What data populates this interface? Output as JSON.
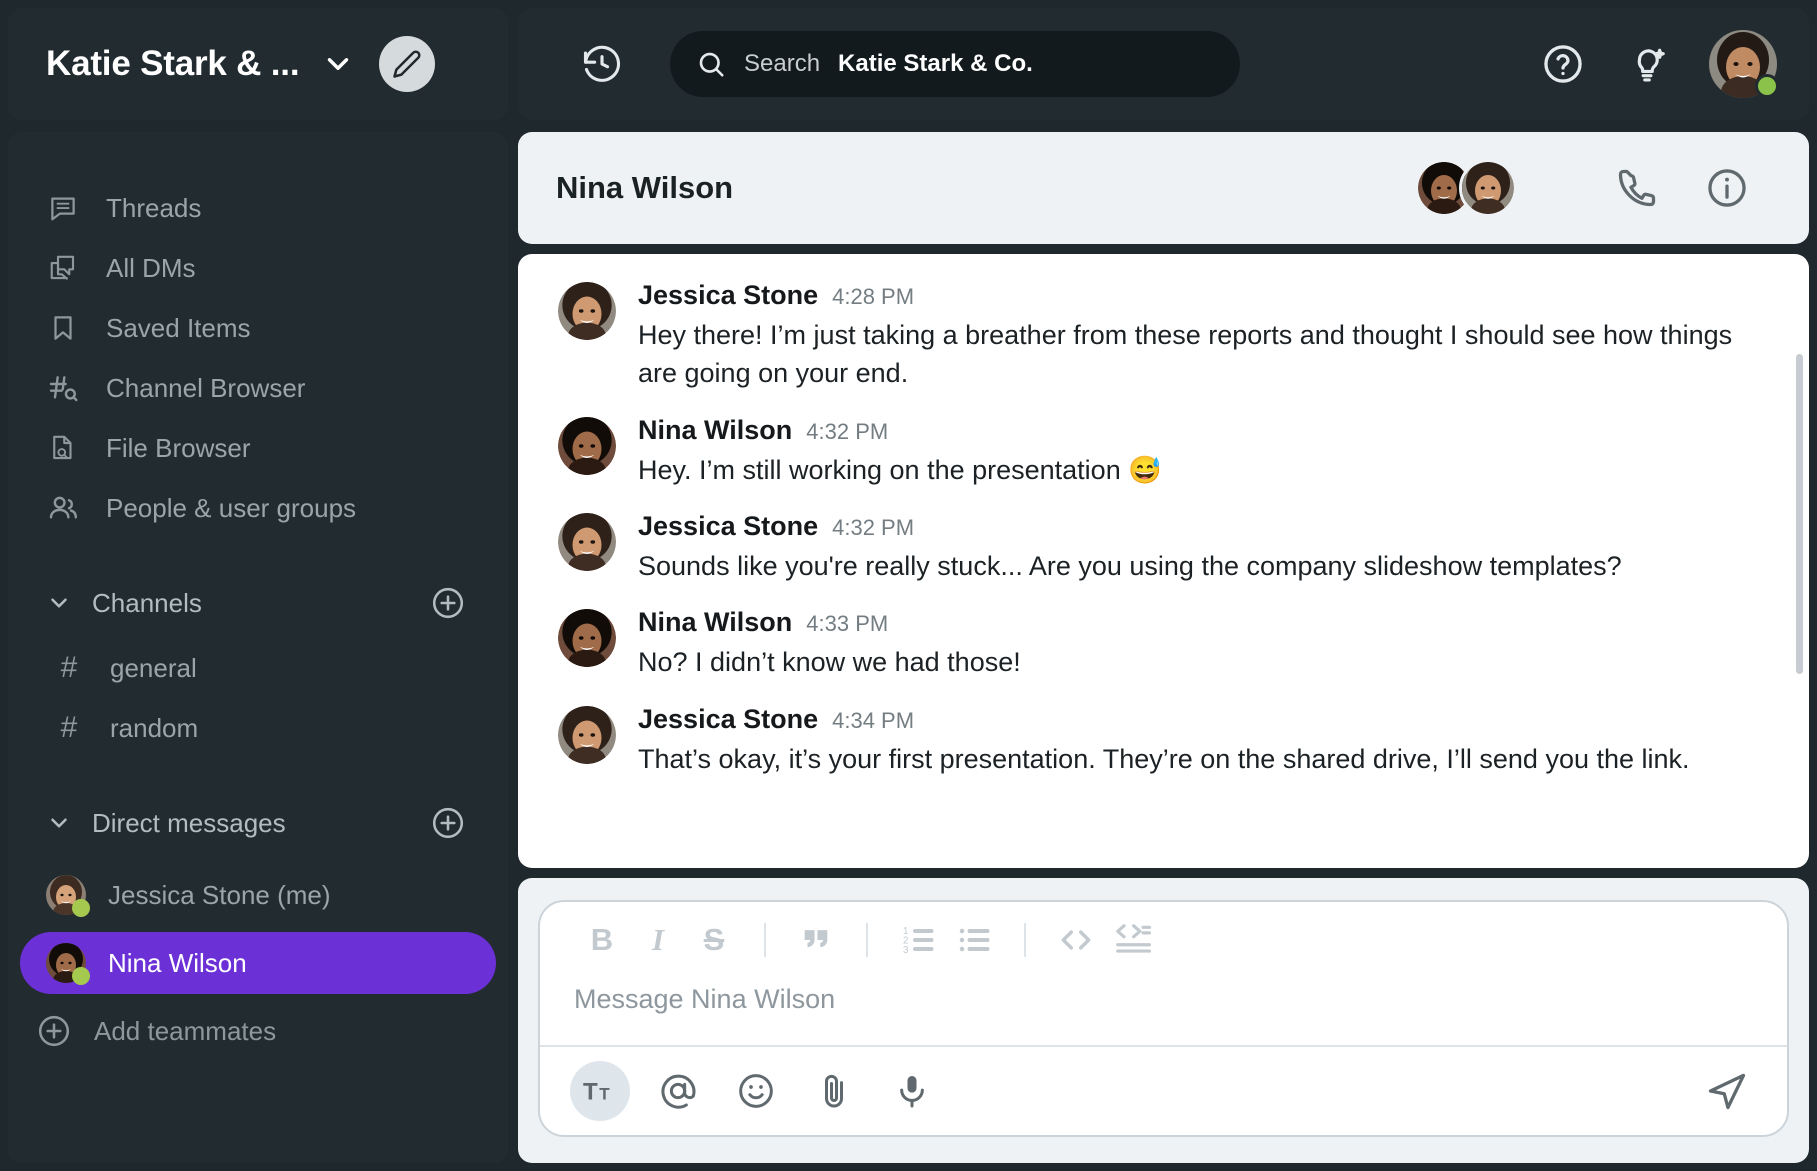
{
  "workspace": {
    "name": "Katie Stark & ...",
    "chevron_icon": "chevron-down-icon",
    "compose_icon": "pencil-edit-icon"
  },
  "header": {
    "history_icon": "history-clock-icon",
    "search": {
      "icon": "search-icon",
      "label": "Search",
      "scope": "Katie Stark & Co."
    },
    "help_icon": "help-circle-icon",
    "ideas_icon": "lightbulb-sparkle-icon",
    "avatar_icon": "user-avatar",
    "status_color": "#8bc34a"
  },
  "sidebar": {
    "nav_items": [
      {
        "label": "Threads",
        "icon": "threads-icon"
      },
      {
        "label": "All DMs",
        "icon": "all-dms-icon"
      },
      {
        "label": "Saved Items",
        "icon": "bookmark-icon"
      },
      {
        "label": "Channel Browser",
        "icon": "channel-search-icon"
      },
      {
        "label": "File Browser",
        "icon": "file-search-icon"
      },
      {
        "label": "People & user groups",
        "icon": "people-icon"
      }
    ],
    "channels_section": {
      "label": "Channels",
      "caret_icon": "chevron-down-icon",
      "add_icon": "plus-circle-icon",
      "items": [
        {
          "label": "general",
          "prefix": "#"
        },
        {
          "label": "random",
          "prefix": "#"
        }
      ]
    },
    "dm_section": {
      "label": "Direct messages",
      "caret_icon": "chevron-down-icon",
      "add_icon": "plus-circle-icon",
      "items": [
        {
          "label": "Jessica Stone (me)",
          "active": false,
          "presence": "online"
        },
        {
          "label": "Nina Wilson",
          "active": true,
          "presence": "online"
        }
      ],
      "add_teammates": {
        "label": "Add teammates",
        "icon": "plus-circle-icon"
      }
    },
    "active_color": "#6b30d6"
  },
  "conversation": {
    "title": "Nina Wilson",
    "member_avatars": [
      "nina-wilson-avatar",
      "jessica-stone-avatar"
    ],
    "call_icon": "phone-icon",
    "info_icon": "info-circle-icon",
    "messages": [
      {
        "author": "Jessica Stone",
        "time": "4:28 PM",
        "text": "Hey there! I’m just taking a breather from these reports and thought I should see how things are going on your end.",
        "avatar": "jessica-stone-avatar"
      },
      {
        "author": "Nina Wilson",
        "time": "4:32 PM",
        "text": "Hey. I’m still working on the presentation 😅",
        "avatar": "nina-wilson-avatar"
      },
      {
        "author": "Jessica Stone",
        "time": "4:32 PM",
        "text": "Sounds like you're really stuck... Are you using the company slideshow templates?",
        "avatar": "jessica-stone-avatar"
      },
      {
        "author": "Nina Wilson",
        "time": "4:33 PM",
        "text": "No? I didn’t know we had those!",
        "avatar": "nina-wilson-avatar"
      },
      {
        "author": "Jessica Stone",
        "time": "4:34 PM",
        "text": "That’s okay, it’s your first presentation. They’re on the shared drive, I’ll send you the link.",
        "avatar": "jessica-stone-avatar"
      }
    ]
  },
  "composer": {
    "placeholder": "Message Nina Wilson",
    "format_buttons": [
      {
        "label": "B",
        "name": "bold-icon"
      },
      {
        "label": "I",
        "name": "italic-icon"
      },
      {
        "label": "S",
        "name": "strikethrough-icon"
      },
      {
        "label": "",
        "name": "blockquote-icon"
      },
      {
        "label": "",
        "name": "ordered-list-icon"
      },
      {
        "label": "",
        "name": "bullet-list-icon"
      },
      {
        "label": "",
        "name": "code-icon"
      },
      {
        "label": "",
        "name": "code-block-icon"
      }
    ],
    "action_buttons": [
      {
        "name": "formatting-toggle-icon",
        "selected": true
      },
      {
        "name": "mention-icon",
        "selected": false
      },
      {
        "name": "emoji-icon",
        "selected": false
      },
      {
        "name": "attachment-icon",
        "selected": false
      },
      {
        "name": "microphone-icon",
        "selected": false
      }
    ],
    "send_icon": "send-icon"
  }
}
